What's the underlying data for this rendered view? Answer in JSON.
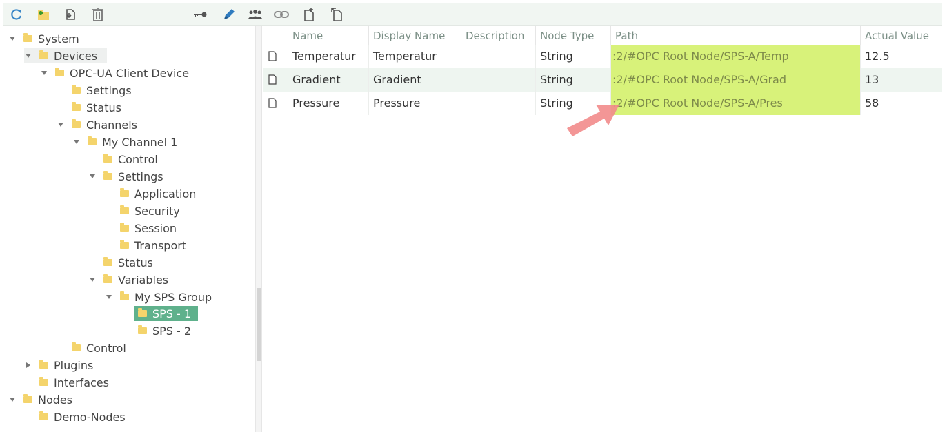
{
  "toolbar": {
    "buttons": [
      {
        "name": "refresh-icon",
        "color": "#3a87c8"
      },
      {
        "name": "add-folder-icon",
        "color": "#6ab04c"
      },
      {
        "name": "import-icon",
        "color": "#555555"
      },
      {
        "name": "delete-icon",
        "color": "#666666"
      },
      {
        "name": "key-icon",
        "color": "#555555"
      },
      {
        "name": "pencil-icon",
        "color": "#2f7bbf"
      },
      {
        "name": "users-icon",
        "color": "#555555"
      },
      {
        "name": "link-icon",
        "color": "#888888"
      },
      {
        "name": "new-document-icon",
        "color": "#555555"
      },
      {
        "name": "new-child-document-icon",
        "color": "#555555"
      }
    ]
  },
  "tree": {
    "items": [
      {
        "label": "System",
        "expanded": true,
        "has_children": true
      },
      {
        "label": "Devices",
        "expanded": true,
        "has_children": true
      },
      {
        "label": "OPC-UA Client Device",
        "expanded": true,
        "has_children": true
      },
      {
        "label": "Settings",
        "has_children": false
      },
      {
        "label": "Status",
        "has_children": false
      },
      {
        "label": "Channels",
        "expanded": true,
        "has_children": true
      },
      {
        "label": "My Channel 1",
        "expanded": true,
        "has_children": true
      },
      {
        "label": "Control",
        "has_children": false
      },
      {
        "label": "Settings",
        "expanded": true,
        "has_children": true
      },
      {
        "label": "Application",
        "has_children": false
      },
      {
        "label": "Security",
        "has_children": false
      },
      {
        "label": "Session",
        "has_children": false
      },
      {
        "label": "Transport",
        "has_children": false
      },
      {
        "label": "Status",
        "has_children": false
      },
      {
        "label": "Variables",
        "expanded": true,
        "has_children": true
      },
      {
        "label": "My SPS Group",
        "expanded": true,
        "has_children": true
      },
      {
        "label": "SPS - 1",
        "has_children": false,
        "selected": true
      },
      {
        "label": "SPS - 2",
        "has_children": false
      },
      {
        "label": "Control",
        "has_children": false
      },
      {
        "label": "Plugins",
        "expanded": false,
        "has_children": true
      },
      {
        "label": "Interfaces",
        "has_children": false
      },
      {
        "label": "Nodes",
        "expanded": true,
        "has_children": true
      },
      {
        "label": "Demo-Nodes",
        "has_children": false
      }
    ]
  },
  "grid": {
    "columns": [
      "Name",
      "Display Name",
      "Description",
      "Node Type",
      "Path",
      "Actual Value"
    ],
    "rows": [
      {
        "name": "Temperatur",
        "display_name": "Temperatur",
        "description": "",
        "node_type": "String",
        "path": ":2/#OPC Root Node/SPS-A/Temp",
        "actual_value": "12.5"
      },
      {
        "name": "Gradient",
        "display_name": "Gradient",
        "description": "",
        "node_type": "String",
        "path": ":2/#OPC Root Node/SPS-A/Grad",
        "actual_value": "13"
      },
      {
        "name": "Pressure",
        "display_name": "Pressure",
        "description": "",
        "node_type": "String",
        "path": ":2/#OPC Root Node/SPS-A/Pres",
        "actual_value": "58"
      }
    ]
  },
  "colors": {
    "selected_tree_item": "#5fb18c",
    "path_highlight": "#d8f27a",
    "annotation_arrow": "#f28b8b",
    "folder": "#f4d46c"
  }
}
